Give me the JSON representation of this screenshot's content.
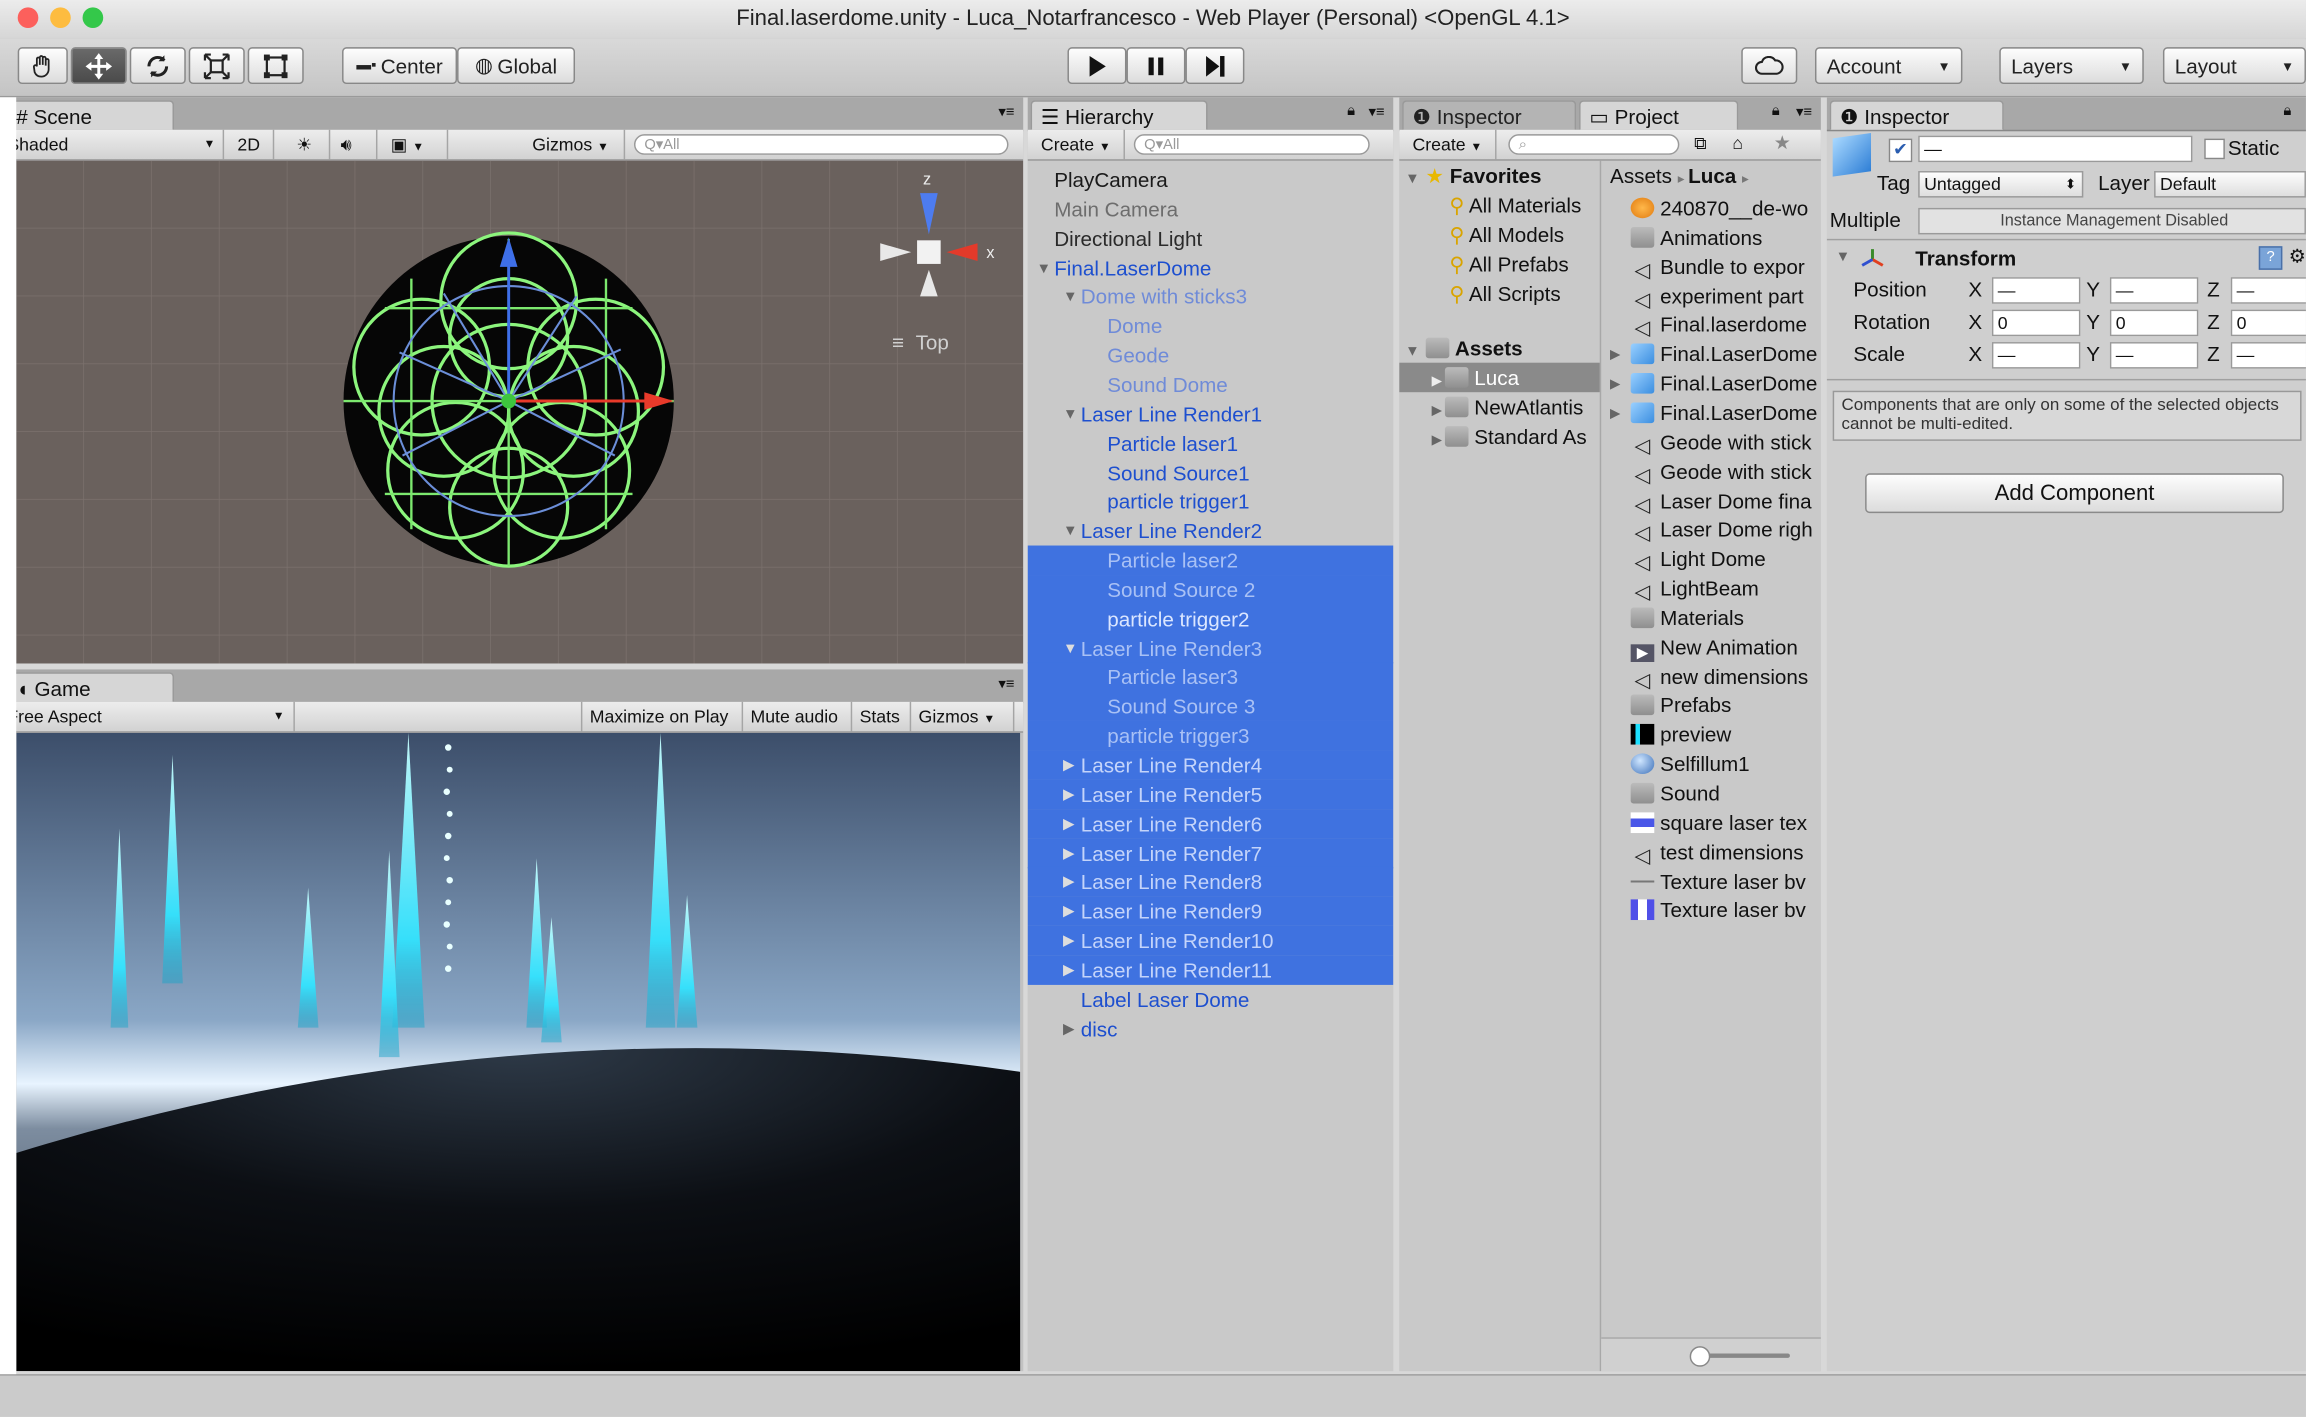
{
  "window": {
    "title": "Final.laserdome.unity - Luca_Notarfrancesco - Web Player (Personal) <OpenGL 4.1>"
  },
  "toolbar": {
    "tool_icons": [
      "hand-icon",
      "move-icon",
      "rotate-icon",
      "scale-icon",
      "rect-icon"
    ],
    "center": "Center",
    "global": "Global",
    "play_icons": [
      "play-icon",
      "pause-icon",
      "step-icon"
    ],
    "cloud_icon": "cloud-icon",
    "account": "Account",
    "layers": "Layers",
    "layout": "Layout"
  },
  "scene": {
    "tab": "Scene",
    "shading": "Shaded",
    "btn_2d": "2D",
    "gizmos": "Gizmos",
    "search_placeholder": "Q▾All",
    "gizmo_axis_z": "z",
    "gizmo_axis_x": "x",
    "view_label": "Top"
  },
  "game": {
    "tab": "Game",
    "aspect": "Free Aspect",
    "maximize": "Maximize on Play",
    "mute": "Mute audio",
    "stats": "Stats",
    "gizmos": "Gizmos"
  },
  "hierarchy": {
    "tab": "Hierarchy",
    "create": "Create",
    "search_placeholder": "Q▾All",
    "rows": [
      {
        "label": "PlayCamera",
        "indent": 0,
        "arrow": "",
        "color": "#1a1a1a",
        "sel": false
      },
      {
        "label": "Main Camera",
        "indent": 0,
        "arrow": "",
        "color": "#6d6d6d",
        "sel": false
      },
      {
        "label": "Directional Light",
        "indent": 0,
        "arrow": "",
        "color": "#2a2a2a",
        "sel": false
      },
      {
        "label": "Final.LaserDome",
        "indent": 0,
        "arrow": "▼",
        "color": "#1d4fcf",
        "sel": false
      },
      {
        "label": "Dome with sticks3",
        "indent": 1,
        "arrow": "▼",
        "color": "#6f8bd8",
        "sel": false
      },
      {
        "label": "Dome",
        "indent": 2,
        "arrow": "",
        "color": "#6f8bd8",
        "sel": false
      },
      {
        "label": "Geode",
        "indent": 2,
        "arrow": "",
        "color": "#6f8bd8",
        "sel": false
      },
      {
        "label": "Sound Dome",
        "indent": 2,
        "arrow": "",
        "color": "#6f8bd8",
        "sel": false
      },
      {
        "label": "Laser Line Render1",
        "indent": 1,
        "arrow": "▼",
        "color": "#1d4fcf",
        "sel": false
      },
      {
        "label": "Particle laser1",
        "indent": 2,
        "arrow": "",
        "color": "#1d4fcf",
        "sel": false
      },
      {
        "label": "Sound Source1",
        "indent": 2,
        "arrow": "",
        "color": "#1d4fcf",
        "sel": false
      },
      {
        "label": "particle trigger1",
        "indent": 2,
        "arrow": "",
        "color": "#1d4fcf",
        "sel": false
      },
      {
        "label": "Laser Line Render2",
        "indent": 1,
        "arrow": "▼",
        "color": "#1d4fcf",
        "sel": false
      },
      {
        "label": "Particle laser2",
        "indent": 2,
        "arrow": "",
        "color": "#a9c1f5",
        "sel": true
      },
      {
        "label": "Sound Source 2",
        "indent": 2,
        "arrow": "",
        "color": "#a9c1f5",
        "sel": true
      },
      {
        "label": "particle trigger2",
        "indent": 2,
        "arrow": "",
        "color": "#dbe6ff",
        "sel": true
      },
      {
        "label": "Laser Line Render3",
        "indent": 1,
        "arrow": "▼",
        "color": "#a9c1f5",
        "sel": true
      },
      {
        "label": "Particle laser3",
        "indent": 2,
        "arrow": "",
        "color": "#a9c1f5",
        "sel": true
      },
      {
        "label": "Sound Source 3",
        "indent": 2,
        "arrow": "",
        "color": "#a9c1f5",
        "sel": true
      },
      {
        "label": "particle trigger3",
        "indent": 2,
        "arrow": "",
        "color": "#a9c1f5",
        "sel": true
      },
      {
        "label": "Laser Line Render4",
        "indent": 1,
        "arrow": "▶",
        "color": "#c4d4fa",
        "sel": true
      },
      {
        "label": "Laser Line Render5",
        "indent": 1,
        "arrow": "▶",
        "color": "#c4d4fa",
        "sel": true
      },
      {
        "label": "Laser Line Render6",
        "indent": 1,
        "arrow": "▶",
        "color": "#c4d4fa",
        "sel": true
      },
      {
        "label": "Laser Line Render7",
        "indent": 1,
        "arrow": "▶",
        "color": "#c4d4fa",
        "sel": true
      },
      {
        "label": "Laser Line Render8",
        "indent": 1,
        "arrow": "▶",
        "color": "#c4d4fa",
        "sel": true
      },
      {
        "label": "Laser Line Render9",
        "indent": 1,
        "arrow": "▶",
        "color": "#c4d4fa",
        "sel": true
      },
      {
        "label": "Laser Line Render10",
        "indent": 1,
        "arrow": "▶",
        "color": "#c4d4fa",
        "sel": true
      },
      {
        "label": "Laser Line Render11",
        "indent": 1,
        "arrow": "▶",
        "color": "#c4d4fa",
        "sel": true
      },
      {
        "label": "Label Laser Dome",
        "indent": 1,
        "arrow": "",
        "color": "#1d4fcf",
        "sel": false
      },
      {
        "label": "disc",
        "indent": 1,
        "arrow": "▶",
        "color": "#1d4fcf",
        "sel": false
      }
    ]
  },
  "project": {
    "inspector_tab": "Inspector",
    "tab": "Project",
    "create": "Create",
    "favorites_title": "Favorites",
    "favorites": [
      "All Materials",
      "All Models",
      "All Prefabs",
      "All Scripts"
    ],
    "assets_title": "Assets",
    "folders": [
      "Luca",
      "NewAtlantis",
      "Standard As"
    ],
    "breadcrumb_root": "Assets",
    "breadcrumb_current": "Luca",
    "files": [
      {
        "name": "240870__de-wo",
        "icon": "asset-orange"
      },
      {
        "name": "Animations",
        "icon": "folder"
      },
      {
        "name": "Bundle to expor",
        "icon": "unity"
      },
      {
        "name": "experiment part",
        "icon": "unity"
      },
      {
        "name": "Final.laserdome",
        "icon": "unity"
      },
      {
        "name": "Final.LaserDome",
        "icon": "prefab"
      },
      {
        "name": "Final.LaserDome",
        "icon": "prefab"
      },
      {
        "name": "Final.LaserDome",
        "icon": "prefab"
      },
      {
        "name": "Geode with stick",
        "icon": "unity"
      },
      {
        "name": "Geode with stick",
        "icon": "unity"
      },
      {
        "name": "Laser Dome fina",
        "icon": "unity"
      },
      {
        "name": "Laser Dome righ",
        "icon": "unity"
      },
      {
        "name": "Light Dome",
        "icon": "unity"
      },
      {
        "name": "LightBeam",
        "icon": "unity"
      },
      {
        "name": "Materials",
        "icon": "folder"
      },
      {
        "name": "New Animation",
        "icon": "anim"
      },
      {
        "name": "new dimensions",
        "icon": "unity"
      },
      {
        "name": "Prefabs",
        "icon": "folder"
      },
      {
        "name": "preview",
        "icon": "texture-dark"
      },
      {
        "name": "Selfillum1",
        "icon": "material"
      },
      {
        "name": "Sound",
        "icon": "folder"
      },
      {
        "name": "square laser tex",
        "icon": "texture-stripe"
      },
      {
        "name": "test dimensions",
        "icon": "unity"
      },
      {
        "name": "Texture laser bv",
        "icon": "texture-line"
      },
      {
        "name": "Texture laser bv",
        "icon": "texture-blue"
      }
    ]
  },
  "inspector": {
    "tab": "Inspector",
    "name_value": "—",
    "static_label": "Static",
    "tag_label": "Tag",
    "tag_value": "Untagged",
    "layer_label": "Layer",
    "layer_value": "Default",
    "multiple_label": "Multiple",
    "instance_mgmt": "Instance Management Disabled",
    "transform_title": "Transform",
    "rows": [
      {
        "label": "Position",
        "x": "—",
        "y": "—",
        "z": "—"
      },
      {
        "label": "Rotation",
        "x": "0",
        "y": "0",
        "z": "0"
      },
      {
        "label": "Scale",
        "x": "—",
        "y": "—",
        "z": "—"
      }
    ],
    "axis_x": "X",
    "axis_y": "Y",
    "axis_z": "Z",
    "note": "Components that are only on some of the selected objects cannot be multi-edited.",
    "add_component": "Add Component"
  },
  "colors": {
    "selection": "#3f72e0",
    "hier_text_blue": "#1d4fcf",
    "laser_cyan": "#33e4ff",
    "dome_green": "#7dff7d"
  }
}
